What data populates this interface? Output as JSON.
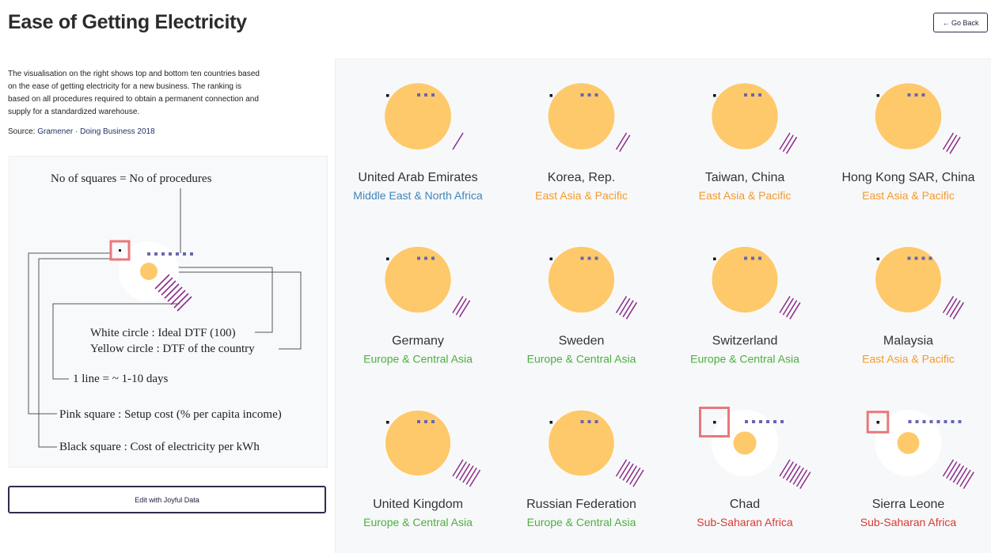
{
  "header": {
    "title": "Ease of Getting Electricity",
    "go_back_label": "← Go Back"
  },
  "intro": {
    "description": "The visualisation on the right shows top and bottom ten countries based on the ease of getting electricity for a new business. The ranking is based on all procedures required to obtain a permanent connection and supply for a standardized warehouse.",
    "source_prefix": "Source: ",
    "source_link": "Gramener · Doing Business 2018"
  },
  "legend": {
    "procedures": "No of squares = No of procedures",
    "white_circle": "White circle : Ideal DTF (100)",
    "yellow_circle": "Yellow circle : DTF of the country",
    "lines": "1 line = ~ 1-10 days",
    "pink_square": "Pink square : Setup cost (% per capita income)",
    "black_square": "Black square : Cost of electricity per kWh"
  },
  "actions": {
    "edit_label": "Edit with Joyful Data"
  },
  "colors": {
    "yellow": "#fec96a",
    "procedure": "#6566b5",
    "line": "#8d2e88",
    "pink": "#e8787a",
    "black": "#111111",
    "white": "#ffffff"
  },
  "region_colors": {
    "Middle East & North Africa": "#3d86b8",
    "East Asia & Pacific": "#f59a2b",
    "Europe & Central Asia": "#4caf3e",
    "Sub-Saharan Africa": "#d93a32"
  },
  "countries": [
    {
      "name": "United Arab Emirates",
      "region": "Middle East & North Africa",
      "dtf": 99.5,
      "procedures": 3,
      "lines": 1,
      "setup_cost": 0
    },
    {
      "name": "Korea, Rep.",
      "region": "East Asia & Pacific",
      "dtf": 99.5,
      "procedures": 3,
      "lines": 2,
      "setup_cost": 0
    },
    {
      "name": "Taiwan, China",
      "region": "East Asia & Pacific",
      "dtf": 99,
      "procedures": 3,
      "lines": 3,
      "setup_cost": 0
    },
    {
      "name": "Hong Kong SAR, China",
      "region": "East Asia & Pacific",
      "dtf": 99,
      "procedures": 3,
      "lines": 3,
      "setup_cost": 0
    },
    {
      "name": "Germany",
      "region": "Europe & Central Asia",
      "dtf": 98.5,
      "procedures": 3,
      "lines": 3,
      "setup_cost": 0
    },
    {
      "name": "Sweden",
      "region": "Europe & Central Asia",
      "dtf": 98.5,
      "procedures": 3,
      "lines": 4,
      "setup_cost": 0
    },
    {
      "name": "Switzerland",
      "region": "Europe & Central Asia",
      "dtf": 98,
      "procedures": 3,
      "lines": 4,
      "setup_cost": 0
    },
    {
      "name": "Malaysia",
      "region": "East Asia & Pacific",
      "dtf": 97.5,
      "procedures": 4,
      "lines": 4,
      "setup_cost": 0
    },
    {
      "name": "United Kingdom",
      "region": "Europe & Central Asia",
      "dtf": 96,
      "procedures": 3,
      "lines": 6,
      "setup_cost": 0
    },
    {
      "name": "Russian Federation",
      "region": "Europe & Central Asia",
      "dtf": 97,
      "procedures": 3,
      "lines": 6,
      "setup_cost": 0
    },
    {
      "name": "Chad",
      "region": "Sub-Saharan Africa",
      "dtf": 12,
      "procedures": 6,
      "lines": 7,
      "setup_cost": 30
    },
    {
      "name": "Sierra Leone",
      "region": "Sub-Saharan Africa",
      "dtf": 11,
      "procedures": 8,
      "lines": 7,
      "setup_cost": 17
    }
  ]
}
